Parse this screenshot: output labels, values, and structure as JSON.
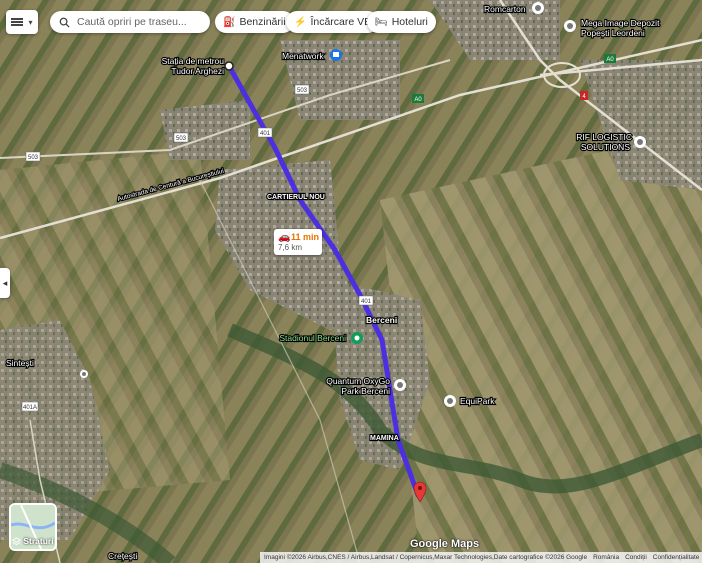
{
  "search": {
    "placeholder": "Caută opriri pe traseu..."
  },
  "chips": [
    {
      "label": "Benzinării",
      "icon": "gas-station-icon"
    },
    {
      "label": "Încărcare VE",
      "icon": "ev-charging-icon"
    },
    {
      "label": "Hoteluri",
      "icon": "hotel-icon"
    }
  ],
  "route": {
    "duration": "11 min",
    "distance": "7,6 km",
    "color": "#4b2fe0"
  },
  "places": {
    "metro_line1": "Stația de metrou",
    "metro_line2": "Tudor Arghezi",
    "menatwork": "Menatwork",
    "romcarton": "Romcarton",
    "mega_line1": "Mega Image Depozit",
    "mega_line2": "Popești Leordeni",
    "rif_line1": "RIF LOGISTIC",
    "rif_line2": "SOLUTIONS",
    "cartierul_nou": "CARTIERUL NOU",
    "berceni": "Berceni",
    "stadionul": "Stadionul Berceni",
    "quantum_line1": "Quantum OxyGo",
    "quantum_line2": "Park Berceni",
    "equipark": "EquiPark",
    "mamina": "MAMINA",
    "sintesti": "Sintești",
    "cretesti": "Crețești",
    "autostrada": "Autostrada de Centură a Bucureștiului"
  },
  "road_shields": {
    "r503a": "503",
    "r503b": "503",
    "r503c": "503",
    "r401a": "401",
    "r401b": "401",
    "r401A": "401A",
    "a0a": "A0",
    "a0b": "A0",
    "r4": "4"
  },
  "layers": {
    "label": "Straturi"
  },
  "attribution": {
    "imagery": "Imagini ©2026 Airbus,CNES / Airbus,Landsat / Copernicus,Maxar Technologies,Date cartografice ©2026 Google",
    "country": "România",
    "terms": "Condiții",
    "privacy": "Confidențialitate",
    "send": "Tr"
  },
  "google_logo": "Google Maps"
}
